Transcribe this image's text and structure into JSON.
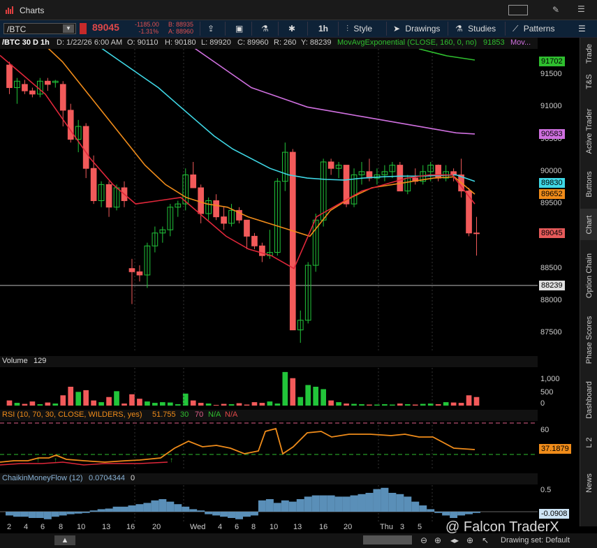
{
  "titlebar": {
    "title": "Charts"
  },
  "toolbar": {
    "symbol": "/BTC",
    "price": "89045",
    "change": "-1185.00",
    "change_pct": "-1.31%",
    "bid": "B: 88935",
    "ask": "A: 88960",
    "timeframe": "1h",
    "style": "Style",
    "drawings": "Drawings",
    "studies": "Studies",
    "patterns": "Patterns"
  },
  "infobar": {
    "symbol": "/BTC 30 D 1h",
    "date": "D: 1/22/26 6:00 AM",
    "open": "O: 90110",
    "high": "H: 90180",
    "low": "L: 89920",
    "close": "C: 89960",
    "range": "R: 260",
    "y": "Y: 88239",
    "study": "MovAvgExponential (CLOSE, 160, 0, no)",
    "study_value": "91853",
    "more": "Mov..."
  },
  "price_axis": {
    "ticks": [
      "91500",
      "91000",
      "90500",
      "90000",
      "89500",
      "89000",
      "88500",
      "88000",
      "87500"
    ],
    "labels": [
      {
        "text": "91702",
        "color": "#2fbf2f"
      },
      {
        "text": "90583",
        "color": "#d070e0"
      },
      {
        "text": "89830",
        "color": "#3fd8e6"
      },
      {
        "text": "89652",
        "color": "#f08c1a"
      },
      {
        "text": "89045",
        "color": "#e65a5a"
      },
      {
        "text": "88239",
        "color": "#e0e0e0"
      }
    ]
  },
  "volume": {
    "title": "Volume",
    "value": "129",
    "ticks": [
      "1,000",
      "500",
      "0"
    ]
  },
  "rsi": {
    "title": "RSI (10, 70, 30, CLOSE, WILDERS, yes)",
    "value": "51.755",
    "ob": "30",
    "os": "70",
    "na1": "N/A",
    "na2": "N/A",
    "ticks": [
      "60"
    ],
    "label": "37.1879"
  },
  "cmf": {
    "title": "ChaikinMoneyFlow (12)",
    "value": "0.0704344",
    "extra": "0",
    "ticks": [
      "0.5"
    ],
    "label": "-0.0908"
  },
  "time_axis": [
    "2",
    "4",
    "6",
    "8",
    "10",
    "13",
    "16",
    "20",
    "Wed",
    "4",
    "6",
    "8",
    "10",
    "13",
    "16",
    "20",
    "Thu",
    "3",
    "5"
  ],
  "sidebar_tabs": [
    "Trade",
    "T&S",
    "Active Trader",
    "Buttons",
    "Chart",
    "Option Chain",
    "Phase Scores",
    "Dashboard",
    "L 2",
    "News"
  ],
  "watermark": "@ Falcon TraderX",
  "drawing_set": "Drawing set: Default",
  "chart_data": {
    "type": "candlestick",
    "title": "/BTC 30 D 1h",
    "ylim": [
      87200,
      91900
    ],
    "x": [
      "2",
      "4",
      "6",
      "8",
      "10",
      "13",
      "16",
      "20",
      "Wed",
      "4",
      "6",
      "8",
      "10",
      "13",
      "16",
      "20",
      "Thu",
      "3",
      "5"
    ],
    "candles": [
      [
        91650,
        91700,
        91200,
        91300
      ],
      [
        91300,
        91450,
        91050,
        91400
      ],
      [
        91350,
        91420,
        91200,
        91250
      ],
      [
        91250,
        91300,
        91150,
        91200
      ],
      [
        91200,
        91450,
        91150,
        91400
      ],
      [
        91400,
        91450,
        91250,
        91350
      ],
      [
        91380,
        91420,
        91300,
        91400
      ],
      [
        91350,
        91400,
        90700,
        90950
      ],
      [
        90950,
        91050,
        90450,
        90500
      ],
      [
        90500,
        90800,
        90300,
        90700
      ],
      [
        90700,
        90750,
        89900,
        90050
      ],
      [
        90050,
        90250,
        89500,
        89550
      ],
      [
        89550,
        89850,
        89450,
        89800
      ],
      [
        89800,
        89850,
        89300,
        89450
      ],
      [
        89450,
        89800,
        89400,
        89750
      ],
      [
        89750,
        89850,
        89450,
        89550
      ],
      [
        88500,
        88650,
        87950,
        88450
      ],
      [
        88450,
        88550,
        88300,
        88400
      ],
      [
        88400,
        88900,
        88200,
        88850
      ],
      [
        88850,
        89150,
        88750,
        89050
      ],
      [
        89050,
        89150,
        88900,
        89100
      ],
      [
        89100,
        89500,
        89000,
        89450
      ],
      [
        89450,
        89550,
        89300,
        89500
      ],
      [
        89500,
        90050,
        89400,
        89950
      ],
      [
        89950,
        90150,
        89750,
        89750
      ],
      [
        89750,
        89800,
        89200,
        89350
      ],
      [
        89350,
        89600,
        89250,
        89550
      ],
      [
        89550,
        89650,
        89250,
        89300
      ],
      [
        89300,
        89450,
        89100,
        89200
      ],
      [
        89200,
        89500,
        89150,
        89400
      ],
      [
        89400,
        89450,
        89200,
        89250
      ],
      [
        89250,
        89250,
        88800,
        89000
      ],
      [
        89000,
        89050,
        88800,
        88850
      ],
      [
        88850,
        88900,
        88600,
        88700
      ],
      [
        88700,
        89100,
        88650,
        88750
      ],
      [
        88750,
        89900,
        88700,
        89850
      ],
      [
        89850,
        90450,
        89700,
        90300
      ],
      [
        90300,
        90350,
        87600,
        87550
      ],
      [
        87550,
        87850,
        87350,
        87700
      ],
      [
        87700,
        88600,
        87650,
        88550
      ],
      [
        88550,
        89350,
        88450,
        89250
      ],
      [
        89250,
        90200,
        89150,
        90150
      ],
      [
        90150,
        90200,
        89950,
        90050
      ],
      [
        90050,
        90150,
        89900,
        90100
      ],
      [
        90100,
        90100,
        89450,
        89500
      ],
      [
        89500,
        90050,
        89450,
        89950
      ],
      [
        89950,
        90150,
        89800,
        90000
      ],
      [
        90000,
        90200,
        89850,
        89900
      ],
      [
        89900,
        90050,
        89800,
        89950
      ],
      [
        89950,
        90100,
        89850,
        90000
      ],
      [
        90000,
        90150,
        89900,
        90100
      ],
      [
        90100,
        90150,
        89700,
        89700
      ],
      [
        89700,
        89950,
        89650,
        89900
      ],
      [
        89900,
        90050,
        89800,
        89850
      ],
      [
        89850,
        90100,
        89800,
        90000
      ],
      [
        90000,
        90150,
        89850,
        90100
      ],
      [
        90100,
        90110,
        89850,
        89900
      ],
      [
        89900,
        90100,
        89850,
        90000
      ],
      [
        90000,
        90050,
        89850,
        89950
      ],
      [
        89950,
        90200,
        89600,
        89700
      ],
      [
        89700,
        89750,
        89000,
        89050
      ],
      [
        89050,
        89300,
        88700,
        89045
      ]
    ],
    "ema_cyan": [
      92100,
      91900,
      91700,
      91500,
      91300,
      91050,
      90800,
      90550,
      90350,
      90200,
      90050,
      89950,
      89900,
      89880,
      89870,
      89900,
      89920,
      89930,
      89930,
      89940,
      89950,
      89850
    ],
    "ema_orange": [
      92000,
      91700,
      91300,
      90900,
      90500,
      90100,
      89800,
      89600,
      89500,
      89450,
      89300,
      89200,
      89100,
      89000,
      89400,
      89600,
      89750,
      89800,
      89850,
      89900,
      89920,
      89652
    ],
    "ema_red": [
      91800,
      91500,
      91200,
      90700,
      90200,
      89800,
      89500,
      89550,
      89600,
      89300,
      89000,
      88800,
      88700,
      88500,
      89300,
      89500,
      89700,
      89800,
      89900,
      89950,
      89950,
      89500
    ],
    "ema_violet": [
      92500,
      92300,
      92100,
      91900,
      91700,
      91500,
      91300,
      91200,
      91100,
      91000,
      90950,
      90900,
      90850,
      90800,
      90750,
      90700,
      90650,
      90600,
      90583
    ]
  }
}
